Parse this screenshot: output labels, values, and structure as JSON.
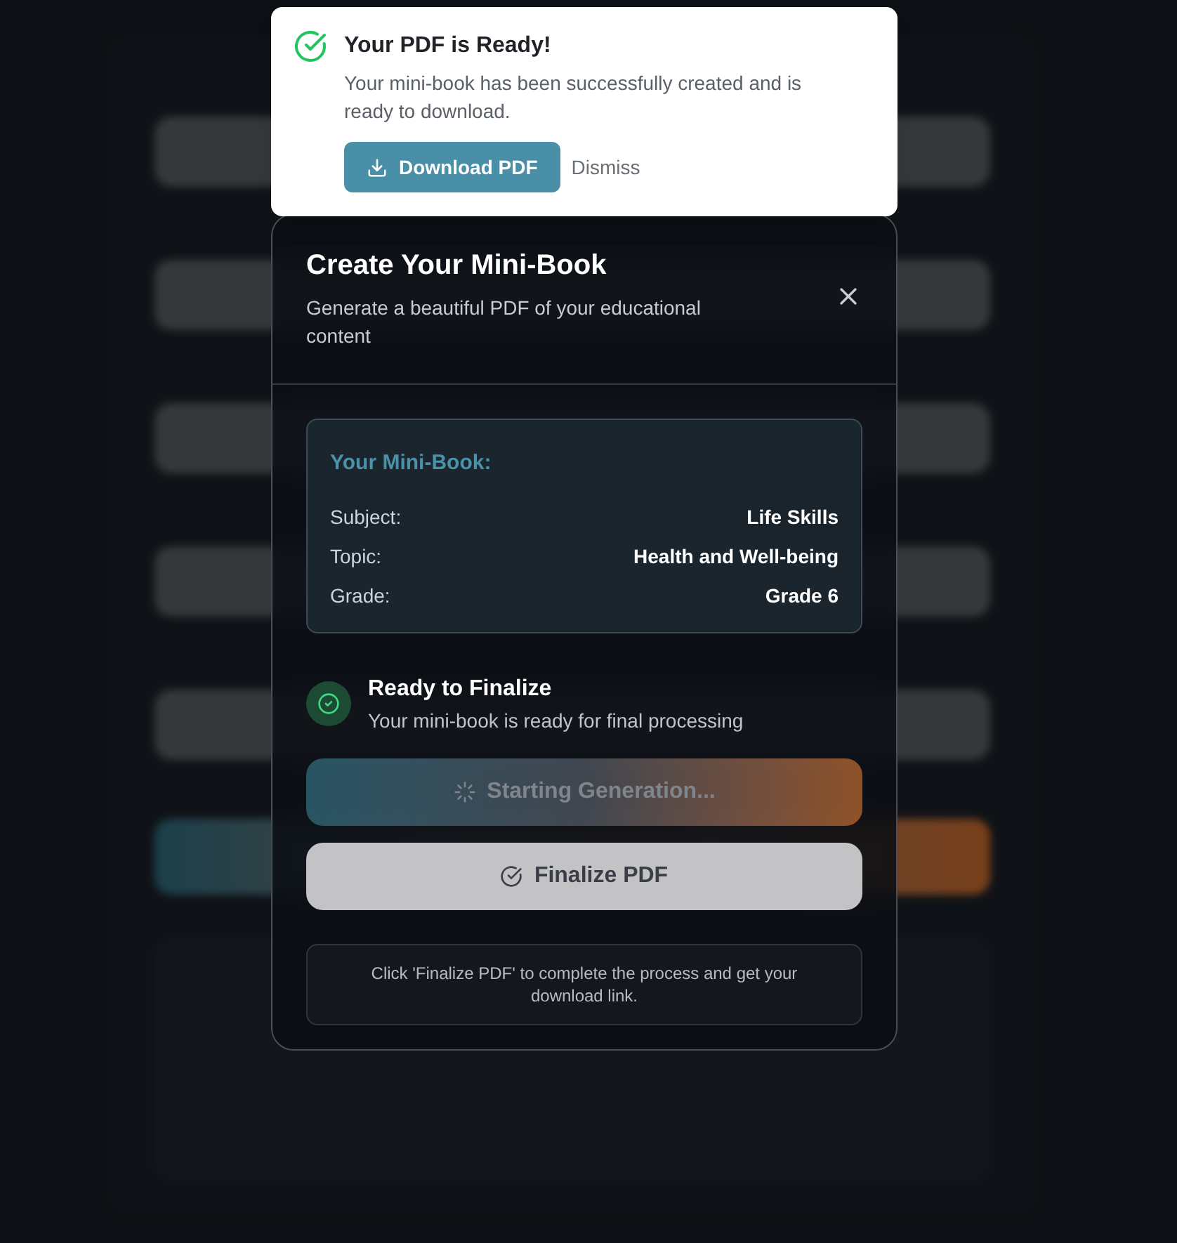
{
  "toast": {
    "title": "Your PDF is Ready!",
    "message": "Your mini-book has been successfully created and is ready to download.",
    "primary_button": "Download PDF",
    "secondary_button": "Dismiss"
  },
  "dialog": {
    "title": "Create Your Mini-Book",
    "subtitle": "Generate a beautiful PDF of your educational content",
    "summary": {
      "heading": "Your Mini-Book:",
      "rows": [
        {
          "label": "Subject:",
          "value": "Life Skills"
        },
        {
          "label": "Topic:",
          "value": "Health and Well-being"
        },
        {
          "label": "Grade:",
          "value": "Grade 6"
        }
      ]
    },
    "status": {
      "title": "Ready to Finalize",
      "message": "Your mini-book is ready for final processing"
    },
    "buttons": [
      {
        "label": "Starting Generation...",
        "kind": "loading",
        "disabled": true
      },
      {
        "label": "Finalize PDF",
        "kind": "finalize",
        "disabled": false
      }
    ],
    "note": "Click 'Finalize PDF' to complete the process and get your download link."
  }
}
